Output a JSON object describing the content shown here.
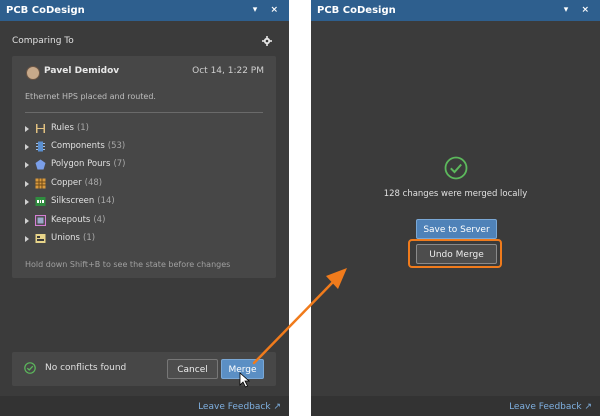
{
  "left_panel": {
    "title": "PCB CoDesign",
    "window_controls": "▾ ×",
    "section_title": "Comparing To",
    "commit": {
      "author": "Pavel Demidov",
      "date": "Oct 14, 1:22 PM",
      "message": "Ethernet HPS placed and routed."
    },
    "tree": [
      {
        "label": "Rules",
        "count": "(1)",
        "icon": "rules-icon"
      },
      {
        "label": "Components",
        "count": "(53)",
        "icon": "components-icon"
      },
      {
        "label": "Polygon Pours",
        "count": "(7)",
        "icon": "polygon-icon"
      },
      {
        "label": "Copper",
        "count": "(48)",
        "icon": "copper-icon"
      },
      {
        "label": "Silkscreen",
        "count": "(14)",
        "icon": "silkscreen-icon"
      },
      {
        "label": "Keepouts",
        "count": "(4)",
        "icon": "keepout-icon"
      },
      {
        "label": "Unions",
        "count": "(1)",
        "icon": "unions-icon"
      }
    ],
    "hint": "Hold down Shift+B to see the state before changes",
    "status": "No conflicts found",
    "cancel_label": "Cancel",
    "merge_label": "Merge",
    "feedback": "Leave Feedback"
  },
  "right_panel": {
    "title": "PCB CoDesign",
    "window_controls": "▾ ×",
    "merged_text": "128 changes were merged locally",
    "save_label": "Save to Server",
    "undo_label": "Undo Merge",
    "feedback": "Leave Feedback"
  },
  "colors": {
    "accent": "#2e5f8e",
    "highlight": "#f07b1c",
    "success": "#4caf50"
  }
}
